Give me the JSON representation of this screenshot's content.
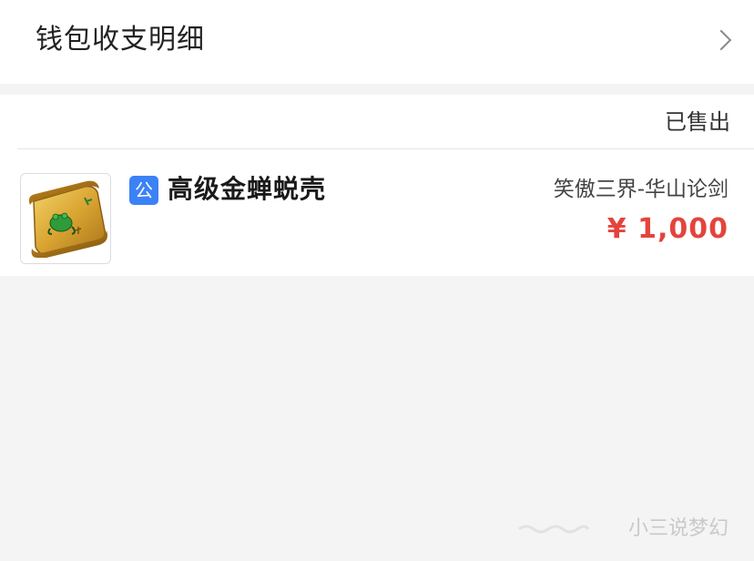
{
  "header": {
    "title": "钱包收支明细",
    "chevron_icon": "chevron-right-icon"
  },
  "order": {
    "status": "已售出",
    "badge": "公",
    "item_name": "高级金蝉蜕壳",
    "server": "笑傲三界-华山论剑",
    "price": "¥ 1,000",
    "thumbnail_icon": "scroll-icon"
  },
  "watermark": {
    "text": "小三说梦幻"
  },
  "colors": {
    "price": "#e5433d",
    "badge": "#3b82f6",
    "background": "#f4f4f4"
  }
}
